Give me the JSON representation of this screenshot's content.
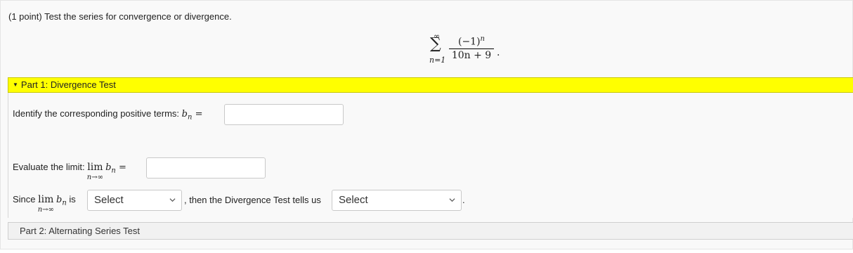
{
  "problem": {
    "prompt": "(1 point) Test the series for convergence or divergence.",
    "series": {
      "upper": "∞",
      "sigma": "∑",
      "lower": "n=1",
      "numerator_base": "(−1)",
      "numerator_exp": "n",
      "denominator": "10n + 9",
      "period": "."
    }
  },
  "part1": {
    "header": "Part 1: Divergence Test",
    "bn_label": "Identify the corresponding positive terms:",
    "b_symbol": "b",
    "n_symbol": "n",
    "eq": "=",
    "limit_label": "Evaluate the limit:",
    "lim_word": "lim",
    "lim_sub": "n→∞",
    "since_label": "Since",
    "is_label": "is",
    "select1_value": "Select",
    "then_text": ", then the Divergence Test tells us",
    "select2_value": "Select",
    "end_period": "."
  },
  "part2": {
    "header": "Part 2: Alternating Series Test"
  }
}
